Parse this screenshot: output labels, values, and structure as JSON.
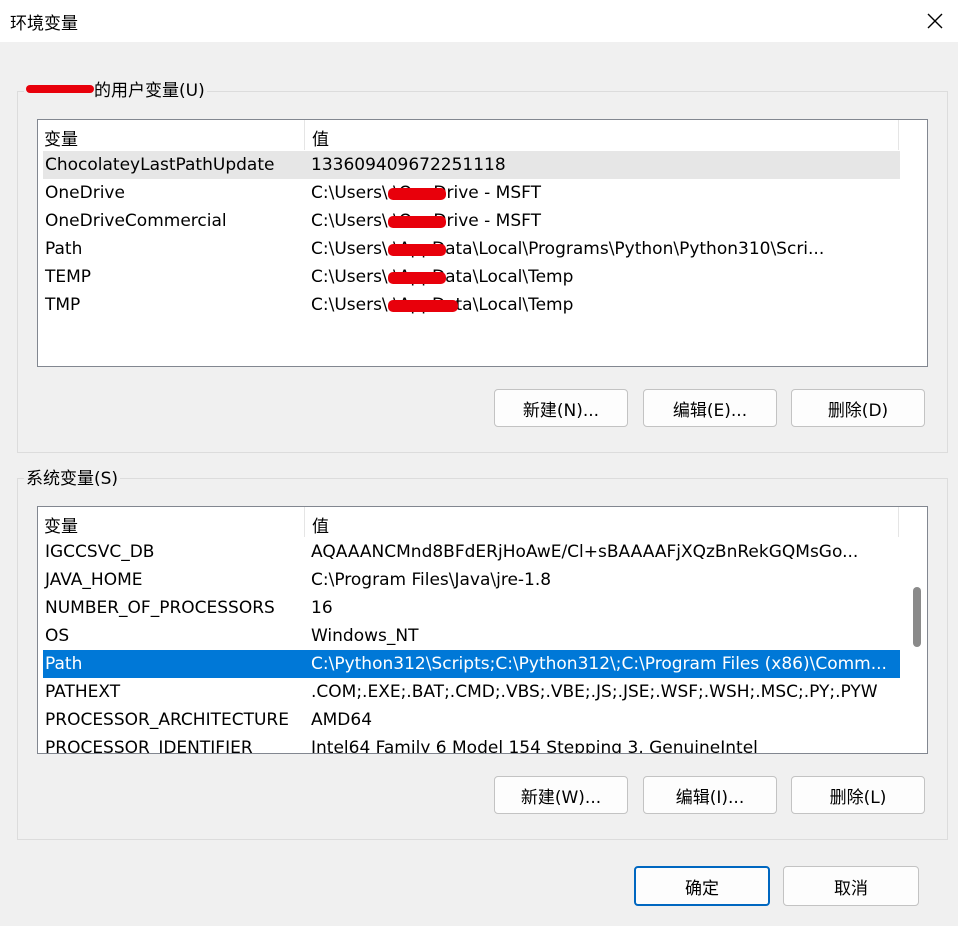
{
  "window": {
    "title": "环境变量",
    "close_label": "✕"
  },
  "user_vars": {
    "group_label_suffix": "的用户变量(U)",
    "header": {
      "name": "变量",
      "value": "值"
    },
    "rows": [
      {
        "name": "ChocolateyLastPathUpdate",
        "value": "133609409672251118"
      },
      {
        "name": "OneDrive",
        "value": "C:\\Users\\       \\OneDrive - MSFT"
      },
      {
        "name": "OneDriveCommercial",
        "value": "C:\\Users\\       \\OneDrive - MSFT"
      },
      {
        "name": "Path",
        "value": "C:\\Users\\       \\AppData\\Local\\Programs\\Python\\Python310\\Scri..."
      },
      {
        "name": "TEMP",
        "value": "C:\\Users\\       \\AppData\\Local\\Temp"
      },
      {
        "name": "TMP",
        "value": "C:\\Users\\       \\AppData\\Local\\Temp"
      }
    ],
    "buttons": {
      "new": "新建(N)...",
      "edit": "编辑(E)...",
      "delete": "删除(D)"
    }
  },
  "system_vars": {
    "group_label": "系统变量(S)",
    "header": {
      "name": "变量",
      "value": "值"
    },
    "rows": [
      {
        "name": "IGCCSVC_DB",
        "value": "AQAAANCMnd8BFdERjHoAwE/Cl+sBAAAAFjXQzBnRekGQMsGo..."
      },
      {
        "name": "JAVA_HOME",
        "value": "C:\\Program Files\\Java\\jre-1.8"
      },
      {
        "name": "NUMBER_OF_PROCESSORS",
        "value": "16"
      },
      {
        "name": "OS",
        "value": "Windows_NT"
      },
      {
        "name": "Path",
        "value": "C:\\Python312\\Scripts;C:\\Python312\\;C:\\Program Files (x86)\\Comm..."
      },
      {
        "name": "PATHEXT",
        "value": ".COM;.EXE;.BAT;.CMD;.VBS;.VBE;.JS;.JSE;.WSF;.WSH;.MSC;.PY;.PYW"
      },
      {
        "name": "PROCESSOR_ARCHITECTURE",
        "value": "AMD64"
      },
      {
        "name": "PROCESSOR_IDENTIFIER",
        "value": "Intel64 Family 6 Model 154 Stepping 3, GenuineIntel"
      }
    ],
    "selected_index": 4,
    "buttons": {
      "new": "新建(W)...",
      "edit": "编辑(I)...",
      "delete": "删除(L)"
    }
  },
  "footer": {
    "ok": "确定",
    "cancel": "取消"
  },
  "colors": {
    "selection": "#0078d7",
    "redaction": "#e8000b"
  }
}
